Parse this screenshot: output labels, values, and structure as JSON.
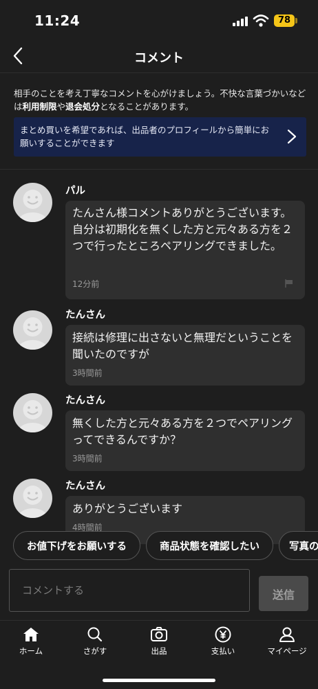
{
  "status_bar": {
    "time": "11:24",
    "battery": "78"
  },
  "header": {
    "title": "コメント"
  },
  "notice": {
    "text_before": "相手のことを考え丁寧なコメントを心がけましょう。不快な言葉づかいなどは",
    "bold_1": "利用制限",
    "text_mid": "や",
    "bold_2": "退会処分",
    "text_after": "となることがあります。"
  },
  "banner": {
    "text": "まとめ買いを希望であれば、出品者のプロフィールから簡単にお願いすることができます"
  },
  "comments": [
    {
      "user": "パル",
      "text": "たんさん様コメントありがとうございます。自分は初期化を無くした方と元々ある方を２つで行ったところペアリングできました。",
      "time": "12分前"
    },
    {
      "user": "たんさん",
      "text": "接続は修理に出さないと無理だということを聞いたのですが",
      "time": "3時間前"
    },
    {
      "user": "たんさん",
      "text": "無くした方と元々ある方を２つでペアリングってできるんですか？",
      "time": "3時間前"
    },
    {
      "user": "たんさん",
      "text": "ありがとうございます",
      "time": "4時間前"
    }
  ],
  "quick_replies": [
    "お値下げをお願いする",
    "商品状態を確認したい",
    "写真の"
  ],
  "input": {
    "placeholder": "コメントする",
    "send_label": "送信"
  },
  "tabs": [
    {
      "label": "ホーム",
      "icon": "home-icon"
    },
    {
      "label": "さがす",
      "icon": "search-icon"
    },
    {
      "label": "出品",
      "icon": "camera-icon"
    },
    {
      "label": "支払い",
      "icon": "yen-icon"
    },
    {
      "label": "マイページ",
      "icon": "person-icon"
    }
  ],
  "colors": {
    "background": "#1e1e1e",
    "banner": "#17234a",
    "bubble": "#2f2f2f",
    "battery": "#f5c518"
  }
}
